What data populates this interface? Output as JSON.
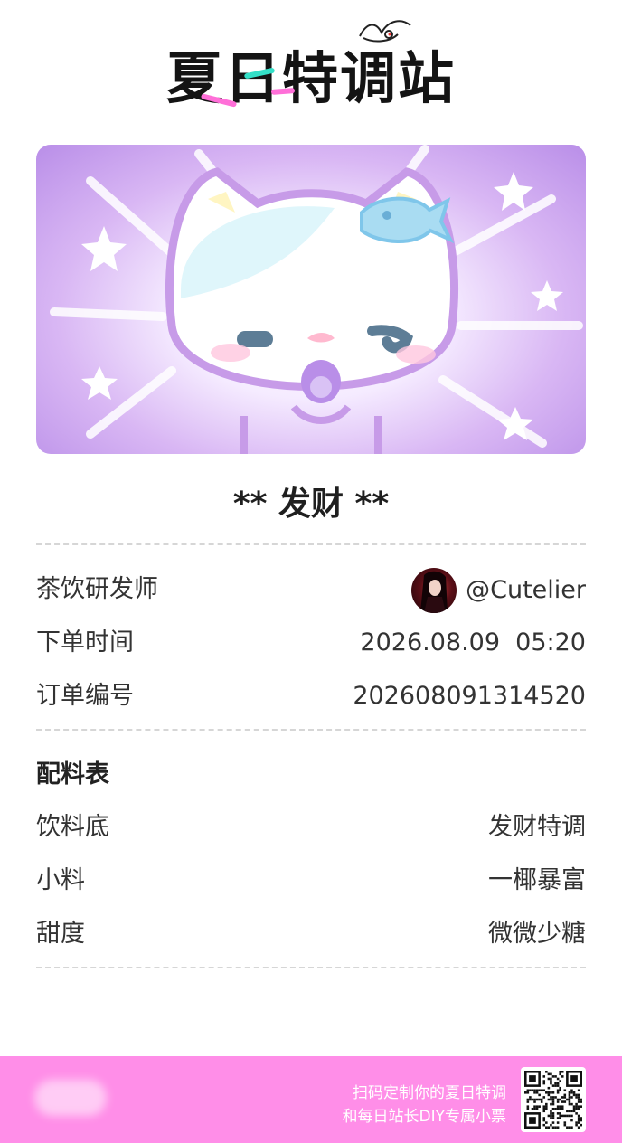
{
  "brand": {
    "logo_text": [
      "夏",
      "日",
      "特",
      "调",
      "站"
    ]
  },
  "card": {
    "title": "** 发财 **"
  },
  "info": {
    "rows": [
      {
        "label": "茶饮研发师",
        "value": "@Cutelier"
      },
      {
        "label": "下单时间",
        "value": "2026.08.09  05:20"
      },
      {
        "label": "订单编号",
        "value": "202608091314520"
      }
    ]
  },
  "ingredients": {
    "title": "配料表",
    "rows": [
      {
        "label": "饮料底",
        "value": "发财特调"
      },
      {
        "label": "小料",
        "value": "一椰暴富"
      },
      {
        "label": "甜度",
        "value": "微微少糖"
      }
    ]
  },
  "footer": {
    "line1": "扫码定制你的夏日特调",
    "line2": "和每日站长DIY专属小票"
  },
  "colors": {
    "footer_bg": "#ff8ee8",
    "banner_purple": "#b98ee8",
    "logo_pink": "#ff6fd8",
    "logo_teal": "#34e0c8"
  }
}
